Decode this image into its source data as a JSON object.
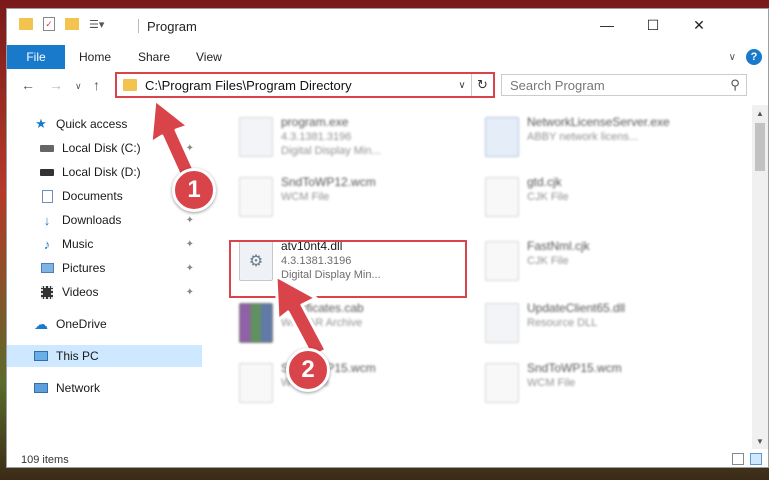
{
  "window": {
    "title": "Program"
  },
  "ribbon": {
    "file": "File",
    "home": "Home",
    "share": "Share",
    "view": "View",
    "help": "?"
  },
  "nav": {
    "address": "C:\\Program Files\\Program Directory",
    "search_placeholder": "Search Program"
  },
  "sidebar": {
    "items": [
      {
        "label": "Quick access",
        "icon": "star-icon"
      },
      {
        "label": "Local Disk (C:)",
        "icon": "drive-icon",
        "pinned": true
      },
      {
        "label": "Local Disk (D:)",
        "icon": "drive-icon",
        "pinned": true
      },
      {
        "label": "Documents",
        "icon": "document-icon",
        "pinned": true
      },
      {
        "label": "Downloads",
        "icon": "download-icon",
        "pinned": true
      },
      {
        "label": "Music",
        "icon": "music-icon",
        "pinned": true
      },
      {
        "label": "Pictures",
        "icon": "picture-icon",
        "pinned": true
      },
      {
        "label": "Videos",
        "icon": "video-icon",
        "pinned": true
      },
      {
        "label": "OneDrive",
        "icon": "cloud-icon"
      },
      {
        "label": "This PC",
        "icon": "computer-icon",
        "selected": true
      },
      {
        "label": "Network",
        "icon": "network-icon"
      }
    ]
  },
  "files": [
    {
      "name": "program.exe",
      "line1": "4.3.1381.3196",
      "line2": "Digital Display Min...",
      "icon": "exe-icon"
    },
    {
      "name": "NetworkLicenseServer.exe",
      "line1": "ABBY network licens...",
      "line2": "",
      "icon": "app-icon"
    },
    {
      "name": "SndToWP12.wcm",
      "line1": "WCM File",
      "line2": "",
      "icon": "file-icon"
    },
    {
      "name": "gtd.cjk",
      "line1": "CJK File",
      "line2": "",
      "icon": "file-icon"
    },
    {
      "name": "atv10nt4.dll",
      "line1": "4.3.1381.3196",
      "line2": "Digital Display Min...",
      "icon": "dll-gear-icon",
      "highlighted": true
    },
    {
      "name": "FastNml.cjk",
      "line1": "CJK File",
      "line2": "",
      "icon": "file-icon"
    },
    {
      "name": "Certificates.cab",
      "line1": "WinRAR Archive",
      "line2": "",
      "icon": "rar-icon"
    },
    {
      "name": "UpdateClient65.dll",
      "line1": "Resource DLL",
      "line2": "",
      "icon": "dll-gear-icon"
    },
    {
      "name": "SndToWP15.wcm",
      "line1": "WCM File",
      "line2": "",
      "icon": "file-icon"
    },
    {
      "name": "SndToWP15.wcm",
      "line1": "WCM File",
      "line2": "",
      "icon": "file-icon"
    }
  ],
  "status": {
    "count": "109 items"
  },
  "annotations": {
    "step1": "1",
    "step2": "2",
    "color": "#d9434a"
  }
}
